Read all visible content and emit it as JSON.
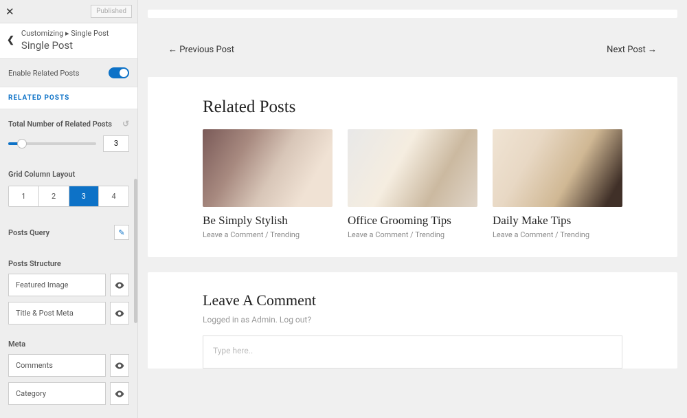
{
  "sidebar": {
    "published": "Published",
    "breadcrumb": "Customizing ▸ Single Post",
    "title": "Single Post",
    "enable_related": "Enable Related Posts",
    "section_related": "RELATED POSTS",
    "total_label": "Total Number of Related Posts",
    "total_value": "3",
    "grid_label": "Grid Column Layout",
    "grid_options": [
      "1",
      "2",
      "3",
      "4"
    ],
    "grid_active": "3",
    "posts_query": "Posts Query",
    "posts_structure": "Posts Structure",
    "structure_items": [
      "Featured Image",
      "Title & Post Meta"
    ],
    "meta_label": "Meta",
    "meta_items": [
      "Comments",
      "Category"
    ]
  },
  "preview": {
    "prev": "← Previous Post",
    "next": "Next Post →",
    "related_title": "Related Posts",
    "posts": [
      {
        "title": "Be Simply Stylish",
        "meta": "Leave a Comment",
        "cat": "Trending"
      },
      {
        "title": "Office Grooming Tips",
        "meta": "Leave a Comment",
        "cat": "Trending"
      },
      {
        "title": "Daily Make Tips",
        "meta": "Leave a Comment",
        "cat": "Trending"
      }
    ],
    "comment_title": "Leave A Comment",
    "logged": "Logged in as Admin. Log out?",
    "placeholder": "Type here.."
  }
}
